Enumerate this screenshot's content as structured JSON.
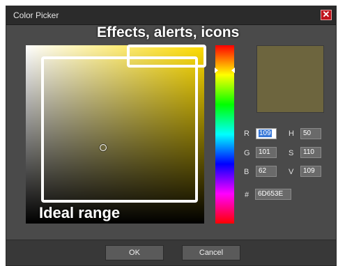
{
  "window": {
    "title": "Color Picker",
    "close_glyph": "✕"
  },
  "annotations": {
    "effects": "Effects, alerts, icons",
    "ideal": "Ideal range"
  },
  "color": {
    "hex_display": "6D653E",
    "preview": "#6D653E",
    "hue_color": "#ffdd00",
    "saturation": 0.43,
    "value": 0.43
  },
  "fields": {
    "r_label": "R",
    "r_value": "109",
    "g_label": "G",
    "g_value": "101",
    "b_label": "B",
    "b_value": "62",
    "h_label": "H",
    "h_value": "50",
    "s_label": "S",
    "s_value": "110",
    "v_label": "V",
    "v_value": "109",
    "hex_label": "#"
  },
  "buttons": {
    "ok": "OK",
    "cancel": "Cancel"
  }
}
